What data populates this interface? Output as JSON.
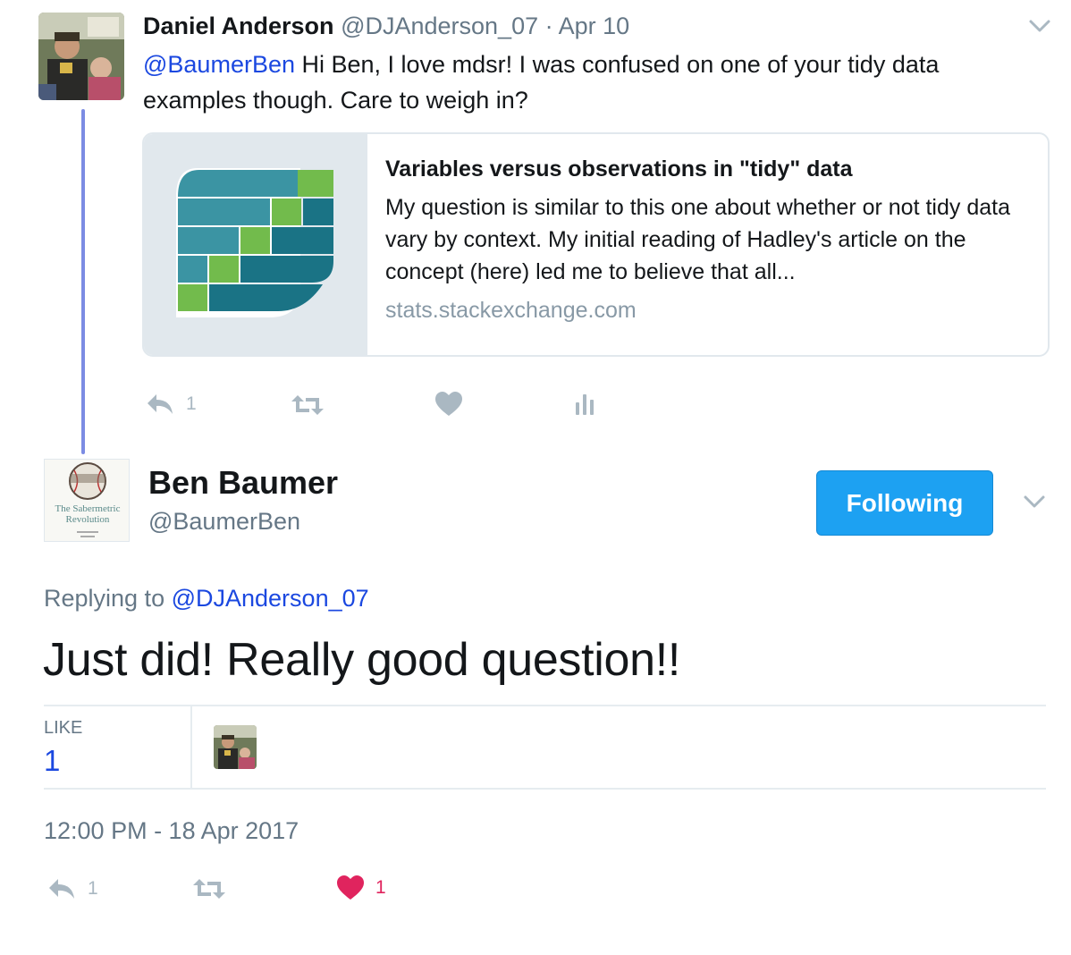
{
  "reply_tweet": {
    "author_name": "Daniel Anderson",
    "author_handle": "@DJAnderson_07",
    "separator": "·",
    "date": "Apr 10",
    "mention": "@BaumerBen",
    "text": " Hi Ben, I love mdsr! I was confused on one of your tidy data examples though. Care to weigh in?",
    "card": {
      "title": "Variables versus observations in \"tidy\" data",
      "description": "My question is similar to this one about whether or not tidy data vary by context. My initial reading of Hadley's article on the concept (here) led me to believe that all...",
      "domain": "stats.stackexchange.com"
    },
    "actions": {
      "reply_count": "1",
      "retweet_count": "",
      "like_count": ""
    }
  },
  "main_tweet": {
    "author_name": "Ben Baumer",
    "author_handle": "@BaumerBen",
    "follow_button": "Following",
    "replying_prefix": "Replying to ",
    "replying_to": "@DJAnderson_07",
    "text": "Just did! Really good question!!",
    "like_label": "LIKE",
    "like_count": "1",
    "timestamp": "12:00 PM - 18 Apr 2017",
    "actions": {
      "reply_count": "1",
      "retweet_count": "",
      "like_count": "1"
    }
  },
  "colors": {
    "link": "#1b48e0",
    "follow_button": "#1da1f2",
    "like_red": "#e0245e",
    "muted": "#657786",
    "thread_line": "#7c8ce3"
  },
  "icons": [
    "reply-icon",
    "retweet-icon",
    "heart-icon",
    "analytics-icon",
    "chevron-down-icon"
  ]
}
